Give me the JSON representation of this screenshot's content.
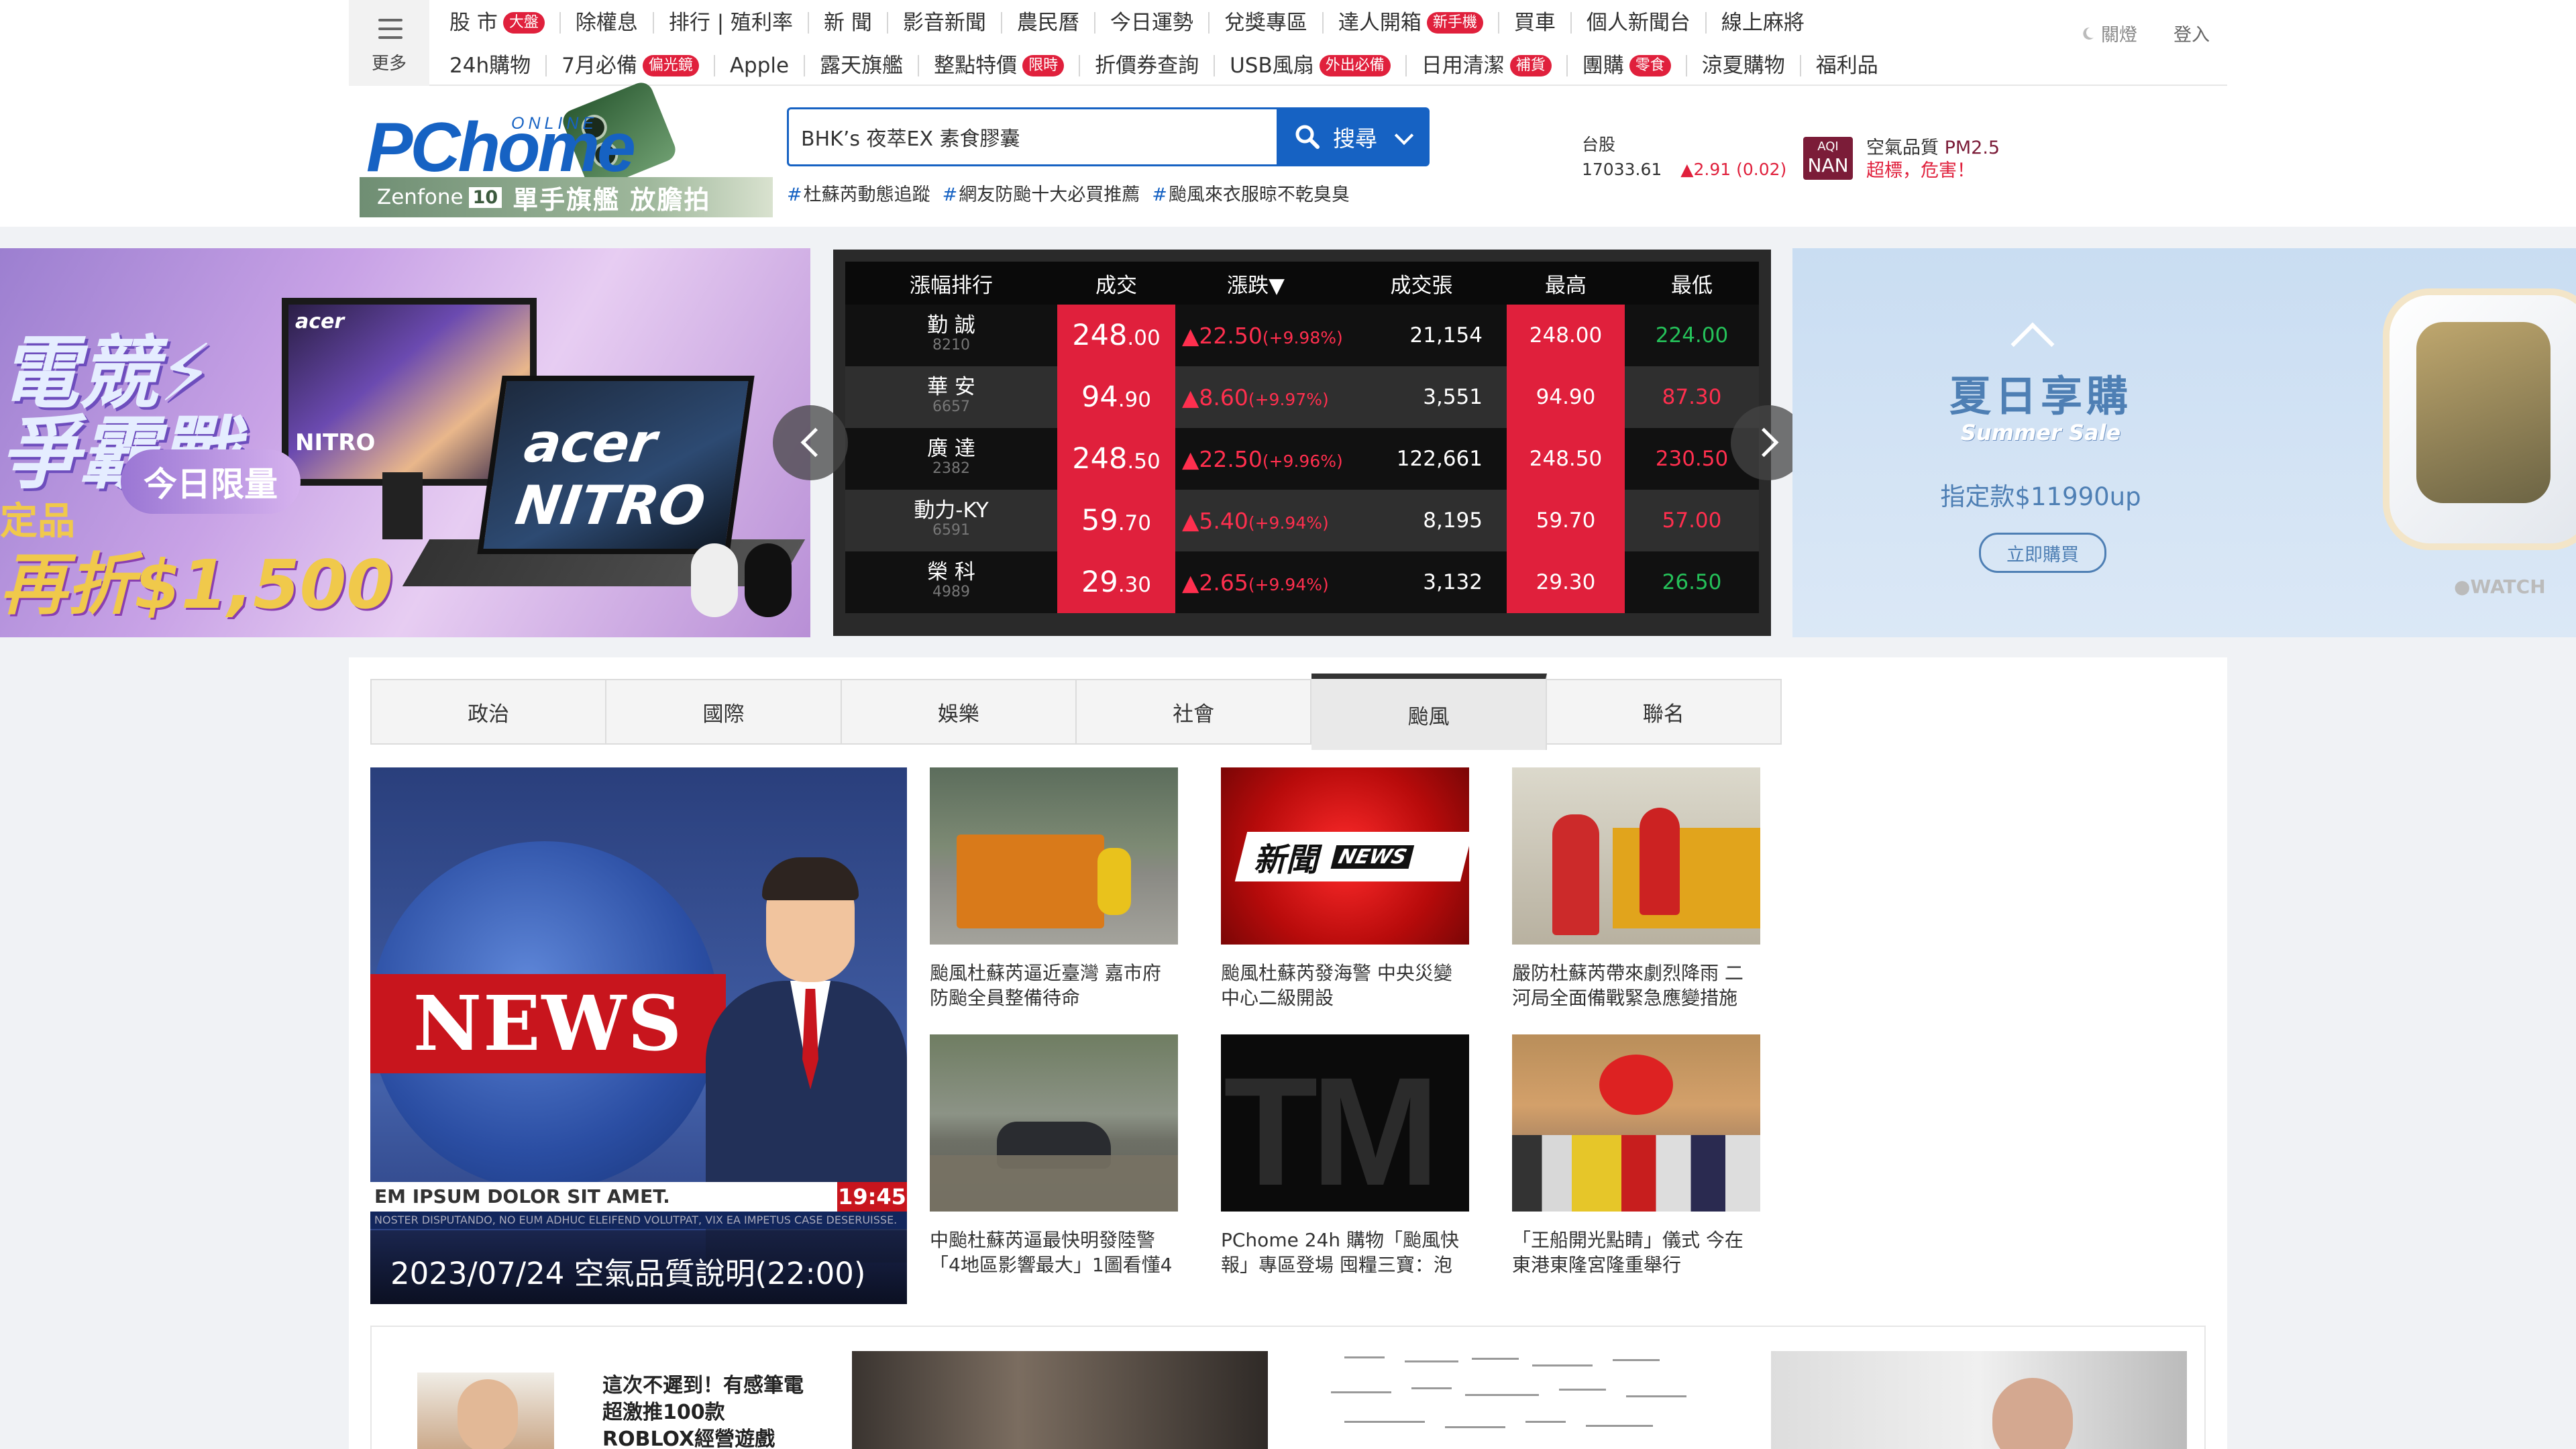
{
  "nav": {
    "more_label": "更多",
    "row1": [
      {
        "label": "股 市",
        "badge": "大盤"
      },
      {
        "label": "除權息"
      },
      {
        "label": "排行 | 殖利率"
      },
      {
        "label": "新 聞"
      },
      {
        "label": "影音新聞"
      },
      {
        "label": "農民曆"
      },
      {
        "label": "今日運勢"
      },
      {
        "label": "兌獎專區"
      },
      {
        "label": "達人開箱",
        "badge": "新手機"
      },
      {
        "label": "買車"
      },
      {
        "label": "個人新聞台"
      },
      {
        "label": "線上麻將"
      }
    ],
    "row2": [
      {
        "label": "24h購物"
      },
      {
        "label": "7月必備",
        "badge": "偏光鏡"
      },
      {
        "label": "Apple"
      },
      {
        "label": "露天旗艦"
      },
      {
        "label": "整點特價",
        "badge": "限時"
      },
      {
        "label": "折價券查詢"
      },
      {
        "label": "USB風扇",
        "badge": "外出必備"
      },
      {
        "label": "日用清潔",
        "badge": "補貨"
      },
      {
        "label": "團購",
        "badge": "零食"
      },
      {
        "label": "涼夏購物"
      },
      {
        "label": "福利品"
      }
    ],
    "light_toggle": "關燈",
    "login": "登入"
  },
  "logo": {
    "brand": "PChome",
    "online": "ONLINE",
    "promo_model": "Zenfone",
    "promo_number": "10",
    "promo_slogan": "單手旗艦 放膽拍"
  },
  "search": {
    "value": "BHK’s 夜萃EX 素食膠囊",
    "button_label": "搜尋",
    "hot_tags": [
      "杜蘇芮動態追蹤",
      "網友防颱十大必買推薦",
      "颱風來衣服晾不乾臭臭"
    ]
  },
  "market": {
    "label": "台股",
    "index": "17033.61",
    "change": "▲2.91 (0.02)"
  },
  "aqi": {
    "label": "AQI",
    "value": "NAN",
    "line1_prefix": "空氣品質",
    "line1_pm": "PM2.5",
    "line2": "超標，危害！"
  },
  "banner_left": {
    "line1": "電競⚡",
    "line2": "爭霸戰",
    "badge": "今日限量",
    "save_prefix": "定品",
    "save_text": "再折$1,500",
    "brand": "acer",
    "laptop_label": "acer NITRO",
    "monitor_label": "NITRO"
  },
  "stock_board": {
    "headers": [
      "漲幅排行",
      "成交",
      "漲跌▼",
      "成交張",
      "最高",
      "最低"
    ],
    "rows": [
      {
        "name": "勤  誠",
        "code": "8210",
        "price_int": "248",
        "price_dec": ".00",
        "chg": "▲22.50",
        "pct": "(+9.98%)",
        "vol": "21,154",
        "high": "248.00",
        "low": "224.00",
        "low_color": "green"
      },
      {
        "name": "華  安",
        "code": "6657",
        "price_int": "94",
        "price_dec": ".90",
        "chg": "▲8.60",
        "pct": "(+9.97%)",
        "vol": "3,551",
        "high": "94.90",
        "low": "87.30",
        "low_color": "red"
      },
      {
        "name": "廣  達",
        "code": "2382",
        "price_int": "248",
        "price_dec": ".50",
        "chg": "▲22.50",
        "pct": "(+9.96%)",
        "vol": "122,661",
        "high": "248.50",
        "low": "230.50",
        "low_color": "red"
      },
      {
        "name": "動力-KY",
        "code": "6591",
        "price_int": "59",
        "price_dec": ".70",
        "chg": "▲5.40",
        "pct": "(+9.94%)",
        "vol": "8,195",
        "high": "59.70",
        "low": "57.00",
        "low_color": "red"
      },
      {
        "name": "榮  科",
        "code": "4989",
        "price_int": "29",
        "price_dec": ".30",
        "chg": "▲2.65",
        "pct": "(+9.94%)",
        "vol": "3,132",
        "high": "29.30",
        "low": "26.50",
        "low_color": "green"
      }
    ]
  },
  "banner_right": {
    "title": "夏日享購",
    "subtitle": "Summer Sale",
    "price": "指定款$11990up",
    "buy_label": "立即購買",
    "watch_logo": "WATCH"
  },
  "news": {
    "tabs": [
      "政治",
      "國際",
      "娛樂",
      "社會",
      "颱風",
      "聯名"
    ],
    "active_tab": 4,
    "hero_caption": "2023/07/24 空氣品質說明(22:00)",
    "hero_ticker": "EM IPSUM DOLOR SIT AMET.",
    "hero_ticker_time": "19:45",
    "hero_ticker_small": "NOSTER DISPUTANDO, NO EUM ADHUC ELEIFEND VOLUTPAT, VIX EA IMPETUS CASE DESERUISSE.",
    "hero_news_text": "NEWS",
    "red_logo_text": "新聞",
    "red_logo_tag": "NEWS",
    "tm_text": "TM",
    "items": [
      {
        "title": "颱風杜蘇芮逼近臺灣 嘉市府防颱全員整備待命"
      },
      {
        "title": "颱風杜蘇芮發海警 中央災變中心二級開設"
      },
      {
        "title": "嚴防杜蘇芮帶來劇烈降雨 二河局全面備戰緊急應變措施"
      },
      {
        "title": "中颱杜蘇芮逼最快明發陸警「4地區影響最大」1圖看懂4"
      },
      {
        "title": "PChome 24h 購物「颱風快報」專區登場 囤糧三寶：泡"
      },
      {
        "title": "「王船開光點睛」儀式 今在東港東隆宮隆重舉行"
      }
    ]
  },
  "bottom": {
    "title": "這次不遲到！有感筆電超激推100款 ROBLOX經營遊戲"
  }
}
